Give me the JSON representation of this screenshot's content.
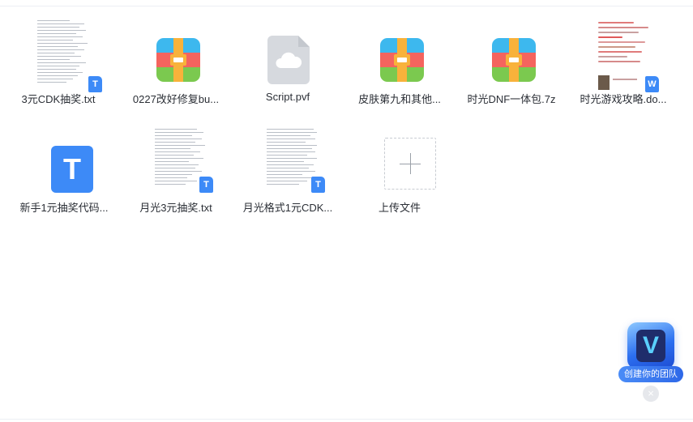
{
  "files": [
    {
      "name": "3元CDK抽奖.txt",
      "icon": "text-doc-icon"
    },
    {
      "name": "0227改好修复bu...",
      "icon": "archive-icon"
    },
    {
      "name": "Script.pvf",
      "icon": "cloud-file-icon"
    },
    {
      "name": "皮肤第九和其他...",
      "icon": "archive-icon"
    },
    {
      "name": "时光DNF一体包.7z",
      "icon": "archive-icon"
    },
    {
      "name": "时光游戏攻略.do...",
      "icon": "word-doc-icon"
    },
    {
      "name": "新手1元抽奖代码...",
      "icon": "text-file-icon"
    },
    {
      "name": "月光3元抽奖.txt",
      "icon": "text-doc-icon"
    },
    {
      "name": "月光格式1元CDK...",
      "icon": "text-doc-icon"
    }
  ],
  "upload": {
    "label": "上传文件"
  },
  "badges": {
    "txt": "T",
    "word": "W",
    "bigT": "T"
  },
  "promo": {
    "label": "创建你的团队",
    "logo_letter": "V",
    "close": "×"
  },
  "colors": {
    "accent": "#3d8af7",
    "text": "#2b2f36",
    "zip_blue": "#3db8ee",
    "zip_red": "#f4645e",
    "zip_green": "#7bc94f",
    "zip_strap": "#f8b23b"
  }
}
